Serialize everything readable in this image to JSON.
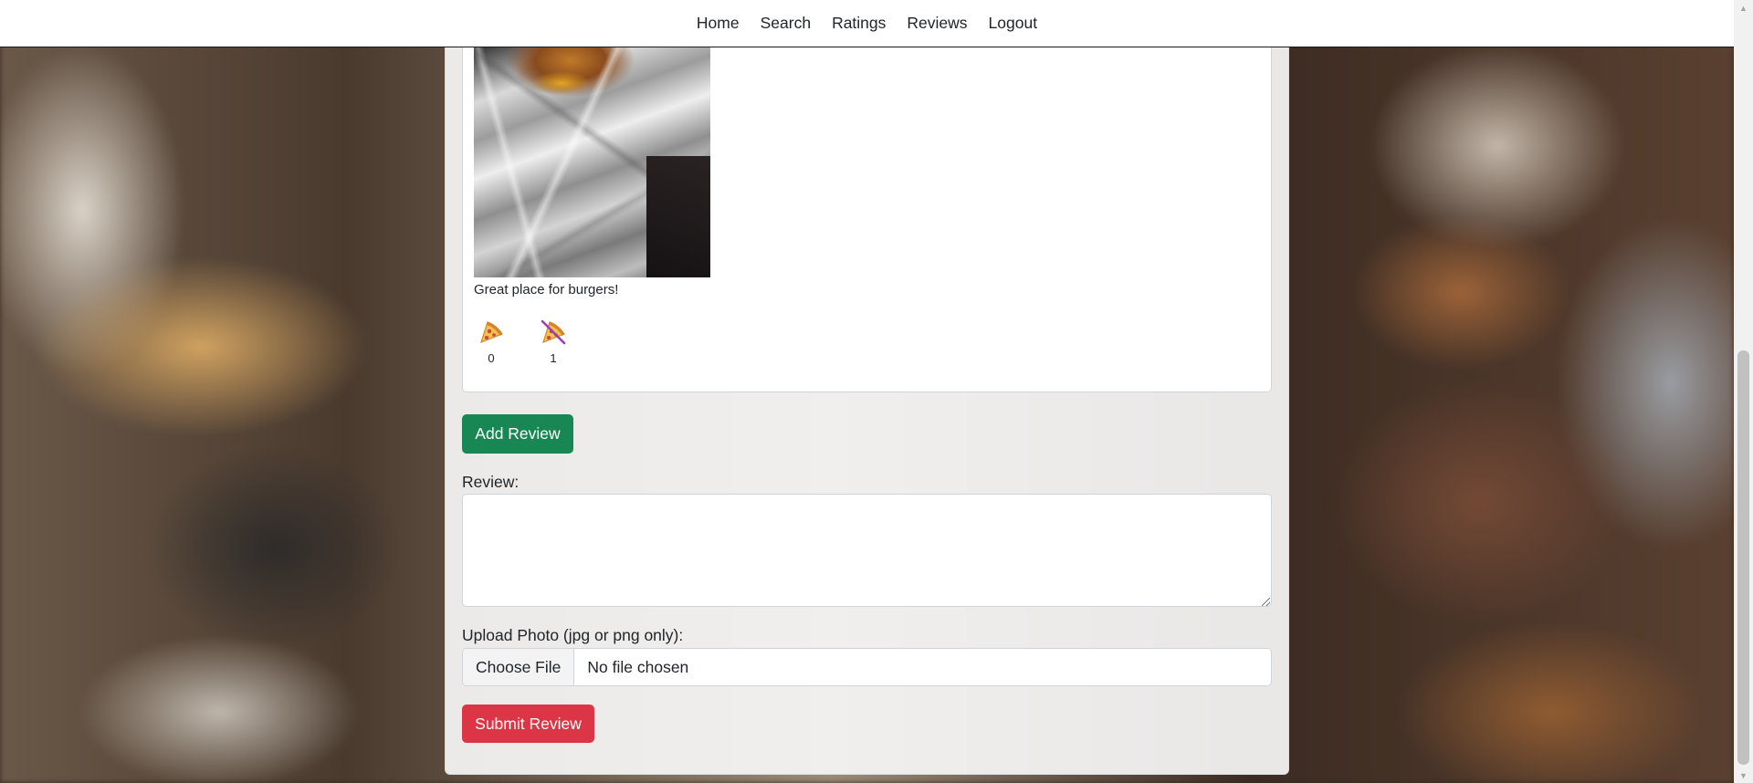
{
  "nav": {
    "links": [
      "Home",
      "Search",
      "Ratings",
      "Reviews",
      "Logout"
    ]
  },
  "review": {
    "text": "Great place for burgers!",
    "upvote_icon": "pizza-icon",
    "downvote_icon": "pizza-crossed-icon",
    "upvotes": "0",
    "downvotes": "1"
  },
  "form": {
    "add_review_label": "Add Review",
    "review_label": "Review:",
    "review_value": "",
    "upload_label": "Upload Photo (jpg or png only):",
    "choose_file_label": "Choose File",
    "file_status": "No file chosen",
    "submit_label": "Submit Review"
  },
  "colors": {
    "add_button": "#198754",
    "submit_button": "#dc3545"
  }
}
